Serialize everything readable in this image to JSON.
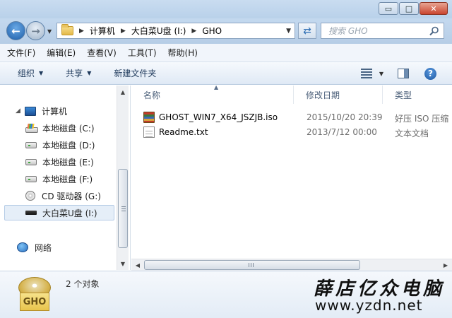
{
  "window": {
    "minimize": "▭",
    "maximize": "□",
    "close": "✕"
  },
  "address": {
    "crumbs": [
      "计算机",
      "大白菜U盘 (I:)",
      "GHO"
    ],
    "search_placeholder": "搜索 GHO"
  },
  "menu": [
    "文件(F)",
    "编辑(E)",
    "查看(V)",
    "工具(T)",
    "帮助(H)"
  ],
  "toolbar": {
    "organize": "组织",
    "share": "共享",
    "new_folder": "新建文件夹",
    "help": "?"
  },
  "nav": {
    "computer": "计算机",
    "drives": [
      {
        "label": "本地磁盘 (C:)",
        "icon": "system-drive-icon"
      },
      {
        "label": "本地磁盘 (D:)",
        "icon": "hard-drive-icon"
      },
      {
        "label": "本地磁盘 (E:)",
        "icon": "hard-drive-icon"
      },
      {
        "label": "本地磁盘 (F:)",
        "icon": "hard-drive-icon"
      },
      {
        "label": "CD 驱动器 (G:)",
        "icon": "cd-drive-icon"
      },
      {
        "label": "大白菜U盘 (I:)",
        "icon": "usb-drive-icon",
        "selected": true
      }
    ],
    "network": "网络"
  },
  "columns": {
    "name": "名称",
    "date": "修改日期",
    "type": "类型"
  },
  "files": [
    {
      "name": "GHOST_WIN7_X64_JSZJB.iso",
      "date": "2015/10/20 20:39",
      "type": "好压 ISO 压缩",
      "icon": "iso-archive-icon"
    },
    {
      "name": "Readme.txt",
      "date": "2013/7/12 00:00",
      "type": "文本文档",
      "icon": "text-file-icon"
    }
  ],
  "status": {
    "count": "2 个对象",
    "icon_label": "GHO"
  },
  "watermark": {
    "site_name": "薛店亿众电脑",
    "url": "www.yzdn.net"
  }
}
